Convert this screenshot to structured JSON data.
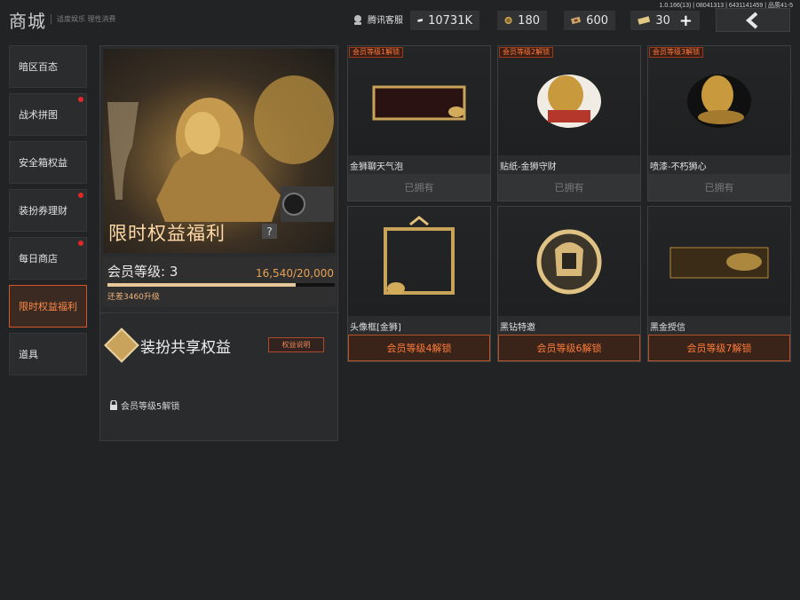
{
  "version": "1.0.166(13) | 08041313 | 6431141459 | 品质41-5",
  "header": {
    "title": "商城",
    "subtitle": "适度娱乐 理性消费",
    "service_label": "腾讯客服",
    "currencies": [
      {
        "icon": "banknote-icon",
        "value": "10731K",
        "color": "#d9d9d9"
      },
      {
        "icon": "gold-coin-icon",
        "value": "180",
        "color": "#c7a055"
      },
      {
        "icon": "ticket-icon",
        "value": "600",
        "color": "#c9a46a"
      },
      {
        "icon": "voucher-icon",
        "value": "30",
        "color": "#e0c882"
      }
    ],
    "plus_label": "+",
    "back_icon": "chevron-left-icon"
  },
  "sidebar": {
    "items": [
      {
        "label": "暗区百态",
        "dot": false,
        "active": false
      },
      {
        "label": "战术拼图",
        "dot": true,
        "active": false
      },
      {
        "label": "安全箱权益",
        "dot": false,
        "active": false
      },
      {
        "label": "装扮券理财",
        "dot": true,
        "active": false
      },
      {
        "label": "每日商店",
        "dot": true,
        "active": false
      },
      {
        "label": "限时权益福利",
        "dot": false,
        "active": true
      },
      {
        "label": "道具",
        "dot": false,
        "active": false
      }
    ]
  },
  "left_panel": {
    "hero_title": "限时权益福利",
    "help_label": "?",
    "level_label": "会员等级: 3",
    "progress_text": "16,540/20,000",
    "progress_fraction": 0.827,
    "level_hint": "还差3460升级",
    "share_title": "装扮共享权益",
    "share_button": "权益说明",
    "share_lock_text": "会员等级5解锁"
  },
  "items": [
    {
      "badge": "会员等级1解锁",
      "name": "金狮聊天气泡",
      "status": "已拥有",
      "locked": false,
      "icon": "chat-bubble-icon"
    },
    {
      "badge": "会员等级2解锁",
      "name": "贴纸-金狮守财",
      "status": "已拥有",
      "locked": false,
      "icon": "lion-sticker-icon"
    },
    {
      "badge": "会员等级3解锁",
      "name": "喷漆-不朽狮心",
      "status": "已拥有",
      "locked": false,
      "icon": "lion-spray-icon"
    },
    {
      "badge": "",
      "name": "头像框[金狮]",
      "status": "会员等级4解锁",
      "locked": true,
      "icon": "avatar-frame-icon"
    },
    {
      "badge": "",
      "name": "黑钻特邀",
      "status": "会员等级6解锁",
      "locked": true,
      "icon": "helmet-emblem-icon"
    },
    {
      "badge": "",
      "name": "黑金授信",
      "status": "会员等级7解锁",
      "locked": true,
      "icon": "gold-card-icon"
    }
  ]
}
